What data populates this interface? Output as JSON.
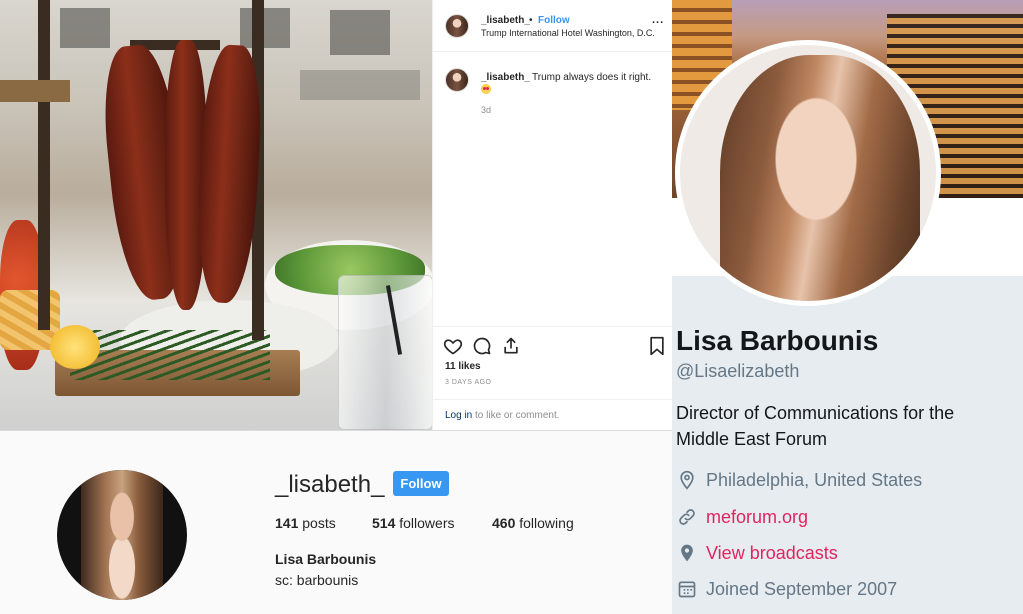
{
  "post": {
    "username": "_lisabeth_",
    "follow_label": "Follow",
    "separator": "•",
    "location": "Trump International Hotel Washington, D.C.",
    "more_label": "...",
    "caption_user": "_lisabeth_",
    "caption_text": "Trump always does it right.",
    "caption_time": "3d",
    "likes": "11 likes",
    "date": "3 DAYS AGO",
    "login_link": "Log in",
    "login_suffix": " to like or comment."
  },
  "ig_profile": {
    "handle": "_lisabeth_",
    "follow_label": "Follow",
    "posts_count": "141",
    "posts_label": " posts",
    "followers_count": "514",
    "followers_label": " followers",
    "following_count": "460",
    "following_label": " following",
    "name": "Lisa Barbounis",
    "bio": "sc: barbounis"
  },
  "twitter": {
    "name": "Lisa Barbounis",
    "handle": "@Lisaelizabeth",
    "bio": "Director of Communications for the Middle East Forum",
    "location": "Philadelphia, United States",
    "website": "meforum.org",
    "broadcasts": "View broadcasts",
    "joined": "Joined September 2007"
  },
  "colors": {
    "instagram_blue": "#3897f0",
    "twitter_link": "#e0245e",
    "twitter_grey": "#657786",
    "twitter_bg": "#e6ecf0"
  },
  "icons": [
    "heart-icon",
    "comment-icon",
    "share-icon",
    "bookmark-icon",
    "location-pin-icon",
    "link-icon",
    "map-marker-icon",
    "calendar-icon"
  ]
}
